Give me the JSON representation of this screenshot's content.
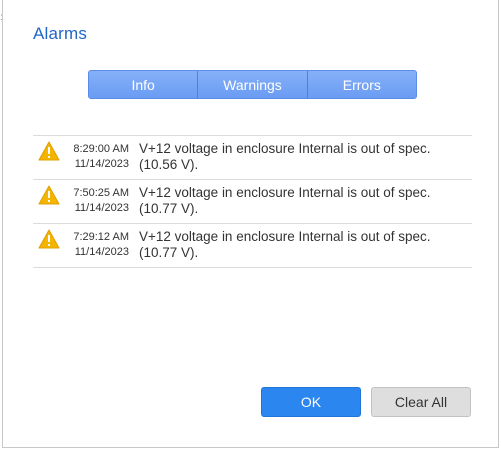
{
  "dialog": {
    "title": "Alarms"
  },
  "tabs": [
    {
      "label": "Info"
    },
    {
      "label": "Warnings"
    },
    {
      "label": "Errors"
    }
  ],
  "alarms": [
    {
      "time": "8:29:00 AM",
      "date": "11/14/2023",
      "message": "V+12 voltage in enclosure Internal is out of spec. (10.56 V).",
      "icon": "warning-triangle-icon"
    },
    {
      "time": "7:50:25 AM",
      "date": "11/14/2023",
      "message": "V+12 voltage in enclosure Internal is out of spec. (10.77 V).",
      "icon": "warning-triangle-icon"
    },
    {
      "time": "7:29:12 AM",
      "date": "11/14/2023",
      "message": "V+12 voltage in enclosure Internal is out of spec. (10.77 V).",
      "icon": "warning-triangle-icon"
    }
  ],
  "buttons": {
    "ok_label": "OK",
    "clear_all_label": "Clear All"
  },
  "colors": {
    "title": "#1f66c9",
    "tab_bg": "#6f9ff5",
    "ok_button": "#2b86f0",
    "clear_button": "#dedede",
    "warning_icon": "#f4b400"
  }
}
